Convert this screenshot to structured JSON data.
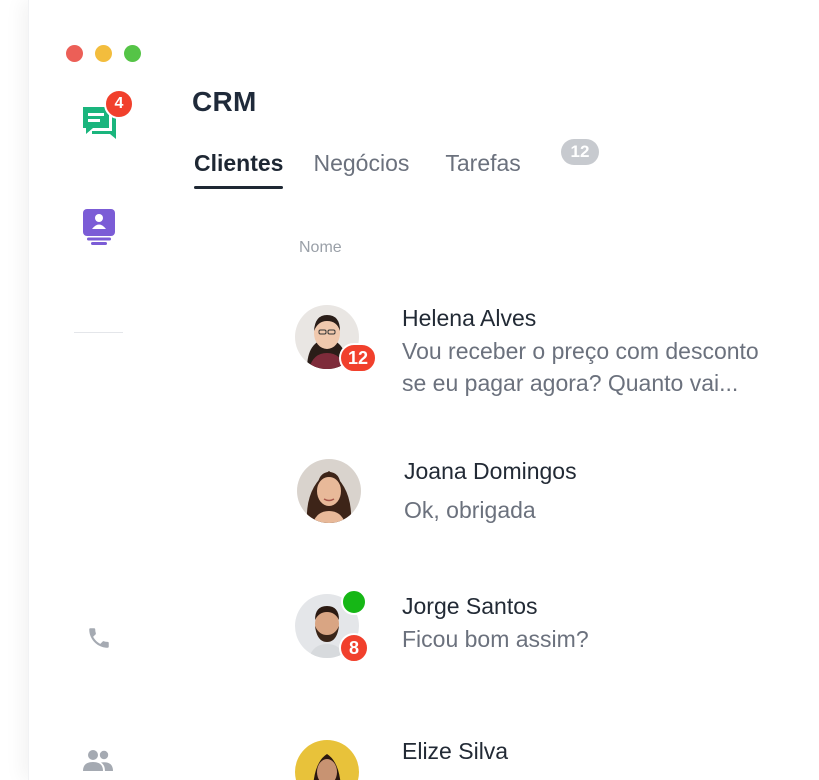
{
  "window": {
    "controls": [
      "close",
      "minimize",
      "zoom"
    ]
  },
  "sidebar": {
    "items": [
      {
        "icon": "chat-icon",
        "badge": "4",
        "color": "#1ab57d"
      },
      {
        "icon": "contacts-icon",
        "color": "#7b5cd6"
      },
      {
        "icon": "phone-icon",
        "color": "#9aa0a8"
      },
      {
        "icon": "people-icon",
        "color": "#9aa0a8"
      }
    ]
  },
  "header": {
    "title": "CRM"
  },
  "tabs": [
    {
      "label": "Clientes",
      "active": true
    },
    {
      "label": "Negócios",
      "active": false
    },
    {
      "label": "Tarefas",
      "active": false,
      "count": "12"
    }
  ],
  "list": {
    "column_header": "Nome",
    "rows": [
      {
        "name": "Helena Alves",
        "message_line1": "Vou receber o preço com desconto",
        "message_line2": "se eu pagar agora? Quanto vai...",
        "unread": "12",
        "online": false
      },
      {
        "name": "Joana Domingos",
        "message_line1": "Ok, obrigada",
        "unread": "",
        "online": false
      },
      {
        "name": "Jorge Santos",
        "message_line1": "Ficou bom assim?",
        "unread": "8",
        "online": true
      },
      {
        "name": "Elize Silva",
        "message_line1": "",
        "unread": "",
        "online": false
      }
    ]
  },
  "colors": {
    "badge": "#f1402c",
    "online": "#16b716",
    "accent_green": "#1ab57d",
    "accent_purple": "#7b5cd6"
  }
}
